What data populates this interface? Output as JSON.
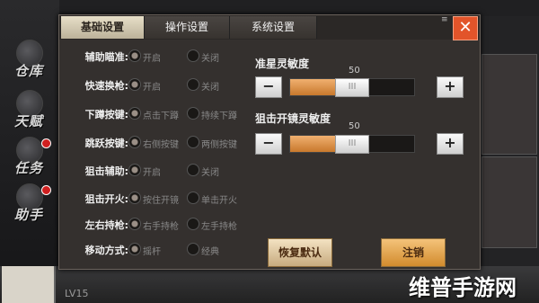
{
  "nav": [
    {
      "label": "仓库",
      "dot": false
    },
    {
      "label": "天赋",
      "dot": false
    },
    {
      "label": "任务",
      "dot": true
    },
    {
      "label": "助手",
      "dot": true
    }
  ],
  "status": {
    "level": "LV15"
  },
  "watermark": "维普手游网",
  "tabs": [
    "基础设置",
    "操作设置",
    "系统设置"
  ],
  "close_label": "✕",
  "settings": [
    {
      "label": "辅助瞄准:",
      "opt1": "开启",
      "opt2": "关闭",
      "selected": 1
    },
    {
      "label": "快速换枪:",
      "opt1": "开启",
      "opt2": "关闭",
      "selected": 1
    },
    {
      "label": "下蹲按键:",
      "opt1": "点击下蹲",
      "opt2": "持续下蹲",
      "selected": 1
    },
    {
      "label": "跳跃按键:",
      "opt1": "右侧按键",
      "opt2": "两侧按键",
      "selected": 1
    },
    {
      "label": "狙击辅助:",
      "opt1": "开启",
      "opt2": "关闭",
      "selected": 1
    },
    {
      "label": "狙击开火:",
      "opt1": "按住开镜",
      "opt2": "单击开火",
      "selected": 1
    },
    {
      "label": "左右持枪:",
      "opt1": "右手持枪",
      "opt2": "左手持枪",
      "selected": 1
    },
    {
      "label": "移动方式:",
      "opt1": "摇杆",
      "opt2": "经典",
      "selected": 1
    }
  ],
  "sensitivity": {
    "crosshair": {
      "title": "准星灵敏度",
      "value": "50",
      "level": 0.5
    },
    "scope": {
      "title": "狙击开镜灵敏度",
      "value": "50",
      "level": 0.5
    }
  },
  "buttons": {
    "minus": "−",
    "plus": "+",
    "thumb": "III",
    "reset": "恢复默认",
    "confirm": "注销"
  },
  "colors": {
    "accent": "#e2542a",
    "slider_fill": "#e09450",
    "active_tab": "#ddd4bc"
  }
}
